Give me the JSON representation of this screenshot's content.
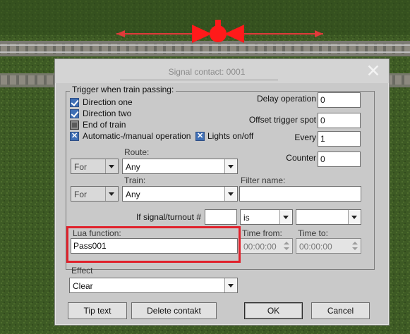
{
  "dialog": {
    "title": "Signal contact: 0001",
    "close_glyph": "✕"
  },
  "trigger": {
    "legend": "Trigger when train passing:",
    "direction_one": {
      "label": "Direction one",
      "checked": true
    },
    "direction_two": {
      "label": "Direction two",
      "checked": true
    },
    "end_of_train": {
      "label": "End of train",
      "checked": false
    },
    "auto_manual": {
      "label": "Automatic-/manual operation",
      "checked": true
    },
    "lights": {
      "label": "Lights on/off",
      "checked": true
    },
    "delay_label": "Delay operation",
    "delay_value": "0",
    "offset_label": "Offset trigger spot",
    "offset_value": "0",
    "every_label": "Every",
    "every_value": "1",
    "counter_label": "Counter",
    "counter_value": "0",
    "route_label": "Route:",
    "route_for": "For",
    "route_value": "Any",
    "train_label": "Train:",
    "train_for": "For",
    "train_value": "Any",
    "filter_label": "Filter name:",
    "filter_value": "",
    "if_signal_label": "If signal/turnout #",
    "if_signal_value": "",
    "is_value": "is",
    "state_value": "",
    "lua_label": "Lua function:",
    "lua_value": "Pass001",
    "time_from_label": "Time from:",
    "time_from_value": "00:00:00",
    "time_to_label": "Time to:",
    "time_to_value": "00:00:00"
  },
  "effect": {
    "label": "Effect",
    "value": "Clear"
  },
  "buttons": {
    "tip_text": "Tip text",
    "delete_contact": "Delete contakt",
    "ok": "OK",
    "cancel": "Cancel"
  },
  "colors": {
    "highlight": "#e0212b",
    "checkbox_blue": "#3f6fb5",
    "signal_red": "#ff1a1a"
  }
}
